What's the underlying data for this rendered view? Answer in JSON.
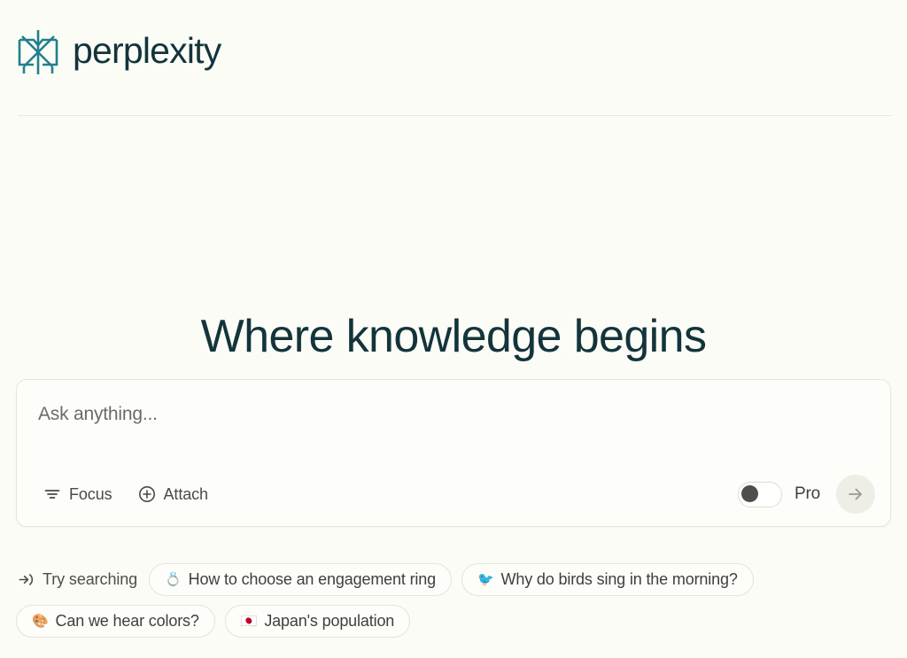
{
  "brand": {
    "name": "perplexity",
    "logo_icon": "perplexity-logo-mark",
    "logo_color": "#20808d",
    "wordmark_color": "#13343b"
  },
  "hero": {
    "title": "Where knowledge begins"
  },
  "search": {
    "placeholder": "Ask anything...",
    "value": "",
    "toolbar": {
      "focus_label": "Focus",
      "focus_icon": "filter-icon",
      "attach_label": "Attach",
      "attach_icon": "plus-circle-icon",
      "pro_label": "Pro",
      "pro_enabled": false,
      "submit_icon": "arrow-right-icon"
    }
  },
  "suggestions": {
    "lead_label": "Try searching",
    "lead_icon": "login-arrow-icon",
    "chips": [
      {
        "emoji": "💍",
        "emoji_name": "ring-emoji",
        "label": "How to choose an engagement ring"
      },
      {
        "emoji": "🐦",
        "emoji_name": "bird-emoji",
        "label": "Why do birds sing in the morning?"
      },
      {
        "emoji": "🎨",
        "emoji_name": "artist-palette-emoji",
        "label": "Can we hear colors?"
      },
      {
        "emoji": "🇯🇵",
        "emoji_name": "japan-flag-emoji",
        "label": "Japan's population"
      }
    ]
  },
  "colors": {
    "page_background": "#fcfcf7",
    "accent_teal": "#20808d",
    "text_dark": "#13343b"
  }
}
